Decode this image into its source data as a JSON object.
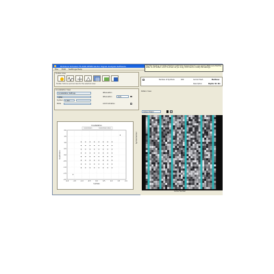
{
  "window": {
    "title": "Rohde & Schwarz FS-K96 OFDM Vector Signal Analysis Software",
    "menu": [
      "File",
      "Edit",
      "Settings",
      "Help"
    ]
  },
  "toolbar_group": {
    "title": "Toolbar Area",
    "hint": "Toolbar hints & quick access for the selected view"
  },
  "constellation": {
    "group_title": "Constellation View",
    "source_select": "Constellation Settings",
    "fields": [
      {
        "label": "",
        "value": "QPSK"
      },
      {
        "label": "Symbol",
        "value": "1 200"
      },
      {
        "label": "Pilots",
        "value": ""
      }
    ],
    "attenuation_label": "Attenuation",
    "attenuation_value": "Auto",
    "limit_label": "Limit Indication",
    "plot_title": "Constellation",
    "legend": [
      "Constellation",
      "Constellation Ideal"
    ],
    "ylabel": "Quadrature",
    "xlabel": "Inphase"
  },
  "info_panel": {
    "tooltip": "Use this heading and status fields to watch the measurement in your signal. Make sure that the slider is not hidden, and it is shown as you drag. Click here to modify the settings.",
    "rows": [
      {
        "label": "Number of Symbols",
        "value": "200",
        "label2": "Carrier Hash",
        "value2": "Multi-lev"
      },
      {
        "label": "",
        "value": "",
        "label2": "Description",
        "value2": "Raptor 91 1ts"
      }
    ]
  },
  "pattern": {
    "group_title": "Pattern View",
    "select": "Output Power",
    "ylabel": "Symbol Number",
    "xlabel": "Carrier Number"
  },
  "chart_data": {
    "type": "scatter",
    "title": "Constellation",
    "xlabel": "Inphase",
    "ylabel": "Quadrature",
    "xlim": [
      -2,
      2
    ],
    "ylim": [
      -2,
      2
    ],
    "grid": true,
    "legend": "top",
    "x_ticks": [
      "-2.0",
      "-1.5",
      "-1.0",
      "-0.5",
      "0.0",
      "0.5",
      "1.0",
      "1.5",
      "2.0"
    ],
    "y_ticks": [
      "2.0",
      "1.5",
      "1.0",
      "0.5",
      "0.0",
      "-0.5",
      "-1.0",
      "-1.5",
      "-2.0"
    ],
    "series": [
      {
        "points": [
          [
            -1.05,
            1.05
          ],
          [
            -0.75,
            1.05
          ],
          [
            -0.45,
            1.05
          ],
          [
            -0.15,
            1.05
          ],
          [
            0.15,
            1.05
          ],
          [
            0.45,
            1.05
          ],
          [
            0.75,
            1.05
          ],
          [
            1.05,
            1.05
          ],
          [
            -1.05,
            0.75
          ],
          [
            -0.75,
            0.75
          ],
          [
            -0.45,
            0.75
          ],
          [
            -0.15,
            0.75
          ],
          [
            0.15,
            0.75
          ],
          [
            0.45,
            0.75
          ],
          [
            0.75,
            0.75
          ],
          [
            1.05,
            0.75
          ],
          [
            -1.05,
            0.45
          ],
          [
            -0.75,
            0.45
          ],
          [
            -0.45,
            0.45
          ],
          [
            -0.15,
            0.45
          ],
          [
            0.15,
            0.45
          ],
          [
            0.45,
            0.45
          ],
          [
            0.75,
            0.45
          ],
          [
            1.05,
            0.45
          ],
          [
            -1.05,
            0.15
          ],
          [
            -0.75,
            0.15
          ],
          [
            -0.45,
            0.15
          ],
          [
            -0.15,
            0.15
          ],
          [
            0.15,
            0.15
          ],
          [
            0.45,
            0.15
          ],
          [
            0.75,
            0.15
          ],
          [
            1.05,
            0.15
          ],
          [
            -1.05,
            -0.15
          ],
          [
            -0.75,
            -0.15
          ],
          [
            -0.45,
            -0.15
          ],
          [
            -0.15,
            -0.15
          ],
          [
            0.15,
            -0.15
          ],
          [
            0.45,
            -0.15
          ],
          [
            0.75,
            -0.15
          ],
          [
            1.05,
            -0.15
          ],
          [
            -1.05,
            -0.45
          ],
          [
            -0.75,
            -0.45
          ],
          [
            -0.45,
            -0.45
          ],
          [
            -0.15,
            -0.45
          ],
          [
            0.15,
            -0.45
          ],
          [
            0.45,
            -0.45
          ],
          [
            0.75,
            -0.45
          ],
          [
            1.05,
            -0.45
          ],
          [
            -1.05,
            -0.75
          ],
          [
            -0.75,
            -0.75
          ],
          [
            -0.45,
            -0.75
          ],
          [
            -0.15,
            -0.75
          ],
          [
            0.15,
            -0.75
          ],
          [
            0.45,
            -0.75
          ],
          [
            0.75,
            -0.75
          ],
          [
            1.05,
            -0.75
          ],
          [
            -1.05,
            -1.05
          ],
          [
            -0.75,
            -1.05
          ],
          [
            -0.45,
            -1.05
          ],
          [
            -0.15,
            -1.05
          ],
          [
            0.15,
            -1.05
          ],
          [
            0.45,
            -1.05
          ],
          [
            0.75,
            -1.05
          ],
          [
            1.05,
            -1.05
          ],
          [
            1.6,
            1.6
          ],
          [
            -1.6,
            -1.6
          ]
        ]
      }
    ]
  },
  "heatmap_data": {
    "type": "heatmap",
    "columns": 40,
    "rows": 36,
    "highlight_columns": [
      3,
      9,
      15,
      22,
      30,
      36
    ],
    "colors": {
      "background": "#0c0c0c",
      "noise_light": "#d9d9d9",
      "highlight": "#2bb5b8"
    }
  },
  "colors": {
    "accent": "#0a58d8",
    "window": "#ece9d8",
    "highlight": "#2bb5b8"
  }
}
